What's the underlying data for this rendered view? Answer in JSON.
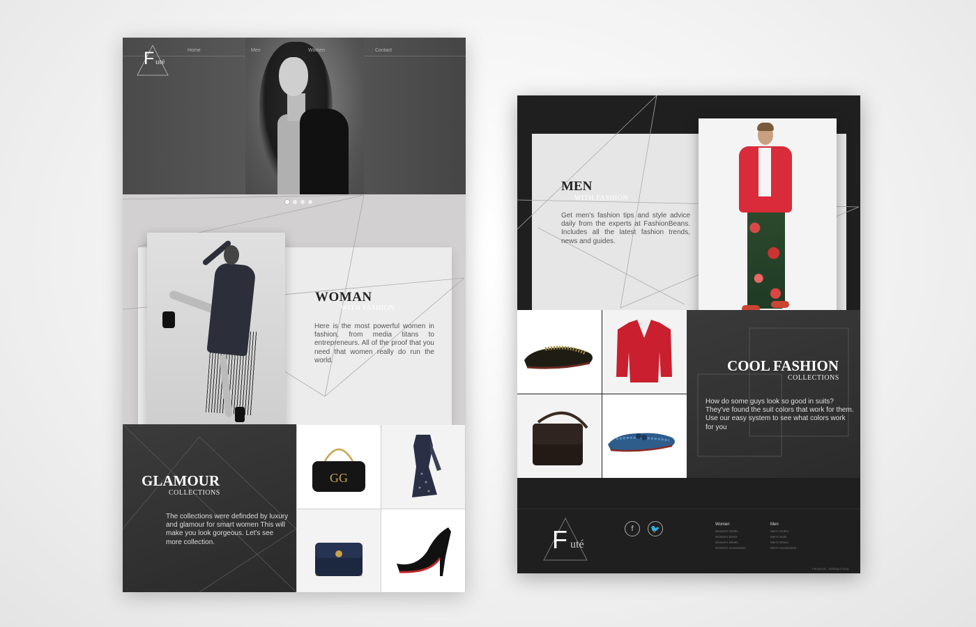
{
  "brand": {
    "logo_letter": "F",
    "logo_suffix": "uté"
  },
  "nav": {
    "items": [
      "Home",
      "Men",
      "Women",
      "Contact"
    ]
  },
  "hero": {
    "slides": 4,
    "active_slide": 1
  },
  "woman": {
    "title": "WOMAN",
    "subtitle": "WITH FASHION",
    "description": "Here is the most powerful women in fashion, from media titans to entrepreneurs. All of the proof that you need that women really do run the world."
  },
  "glamour": {
    "title": "GLAMOUR",
    "subtitle": "COLLECTIONS",
    "description": "The collections were definded by luxury and glamour for smart women This will make you look gorgeous. Let's see more collection."
  },
  "men": {
    "title": "MEN",
    "subtitle": "WITH FASHION",
    "description": "Get men's fashion tips and style advice daily from the experts at FashionBeans. Includes all the latest fashion trends, news and guides."
  },
  "cool": {
    "title": "COOL FASHION",
    "subtitle": "COLLECTIONS",
    "description": "How do some guys look so good in suits? They've found the suit colors that work for them. Use our easy system to see what colors work for you"
  },
  "footer": {
    "social": [
      {
        "icon": "facebook-icon",
        "glyph": "f"
      },
      {
        "icon": "twitter-icon",
        "glyph": "🐦"
      }
    ],
    "women": {
      "heading": "Women",
      "items": [
        "Women's Cloths",
        "Women's Dress",
        "Women's Shoes",
        "Women's Accessories"
      ]
    },
    "men": {
      "heading": "Men",
      "items": [
        "Men's Cloths",
        "Men's Suits",
        "Men's Shoes",
        "Men's Accessories"
      ]
    },
    "credit": "Facebook · Nathapol Sorg"
  },
  "colors": {
    "accent_red": "#d92b3a",
    "dark_panel": "#2b2b2b",
    "light_card": "#ececec"
  }
}
